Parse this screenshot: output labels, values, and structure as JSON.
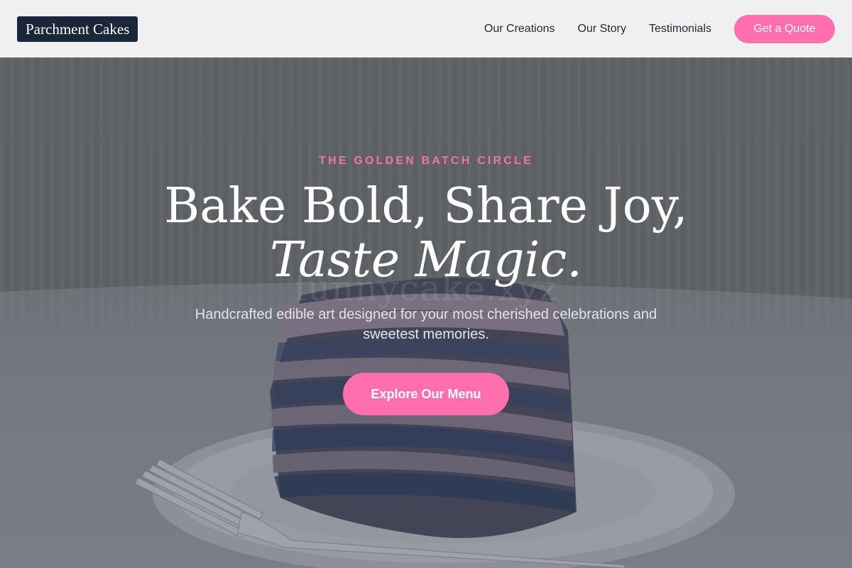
{
  "header": {
    "logo": "Parchment Cakes",
    "nav": [
      "Our Creations",
      "Our Story",
      "Testimonials"
    ],
    "cta_label": "Get a Quote"
  },
  "hero": {
    "eyebrow": "THE GOLDEN BATCH CIRCLE",
    "headline_line1": "Bake Bold, Share Joy,",
    "headline_line2": "Taste Magic.",
    "subtext": "Handcrafted edible art designed for your most cherished celebrations and sweetest memories.",
    "cta_label": "Explore Our Menu",
    "watermark": "funnycake.xyz"
  },
  "colors": {
    "accent": "#ff6fb0",
    "eyebrow": "#f472a8",
    "logo_bg": "#1c2639",
    "header_bg": "#f0f0f0"
  },
  "icons": [
    "cake-photo",
    "fork-image",
    "plate-image"
  ]
}
